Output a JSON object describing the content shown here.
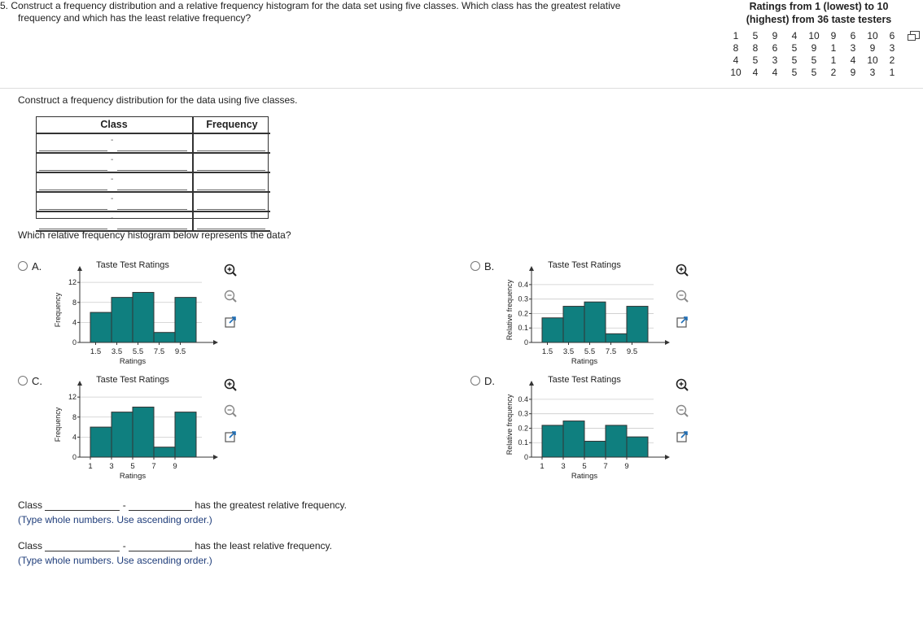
{
  "question": {
    "number": "5.",
    "line1": "Construct a frequency distribution and a relative frequency histogram for the data set using five classes. Which class has the greatest relative",
    "line2": "frequency and which has the least relative frequency?"
  },
  "dataset": {
    "title_line1": "Ratings from 1 (lowest) to 10",
    "title_line2": "(highest) from 36 taste testers",
    "rows": [
      [
        "1",
        "5",
        "9",
        "4",
        "10",
        "9",
        "6",
        "10",
        "6"
      ],
      [
        "8",
        "8",
        "6",
        "5",
        "9",
        "1",
        "3",
        "9",
        "3"
      ],
      [
        "4",
        "5",
        "3",
        "5",
        "5",
        "1",
        "4",
        "10",
        "2"
      ],
      [
        "10",
        "4",
        "4",
        "5",
        "5",
        "2",
        "9",
        "3",
        "1"
      ]
    ]
  },
  "step": {
    "instruction": "Construct a frequency distribution for the data using five classes.",
    "table": {
      "col_class": "Class",
      "col_frequency": "Frequency",
      "row_dash": "-"
    }
  },
  "histogram_question": "Which relative frequency histogram below represents the data?",
  "options": [
    {
      "label": "A.",
      "letter": "A"
    },
    {
      "label": "B.",
      "letter": "B"
    },
    {
      "label": "C.",
      "letter": "C"
    },
    {
      "label": "D.",
      "letter": "D"
    }
  ],
  "answers": {
    "greatest": {
      "prefix": "Class",
      "dash": "-",
      "suffix": "has the greatest relative frequency.",
      "hint": "(Type whole numbers. Use ascending order.)"
    },
    "least": {
      "prefix": "Class",
      "dash": "-",
      "suffix": "has the least relative frequency.",
      "hint": "(Type whole numbers. Use ascending order.)"
    }
  },
  "icons": [
    "zoom-in-icon",
    "zoom-out-icon",
    "open-external-icon",
    "copy-data-icon",
    "radio-icon"
  ],
  "colors": {
    "bar_fill": "#0f7f7f",
    "bar_stroke": "#333333",
    "axis": "#333333",
    "grid": "#cccccc"
  },
  "chart_data": [
    {
      "id": "A",
      "type": "bar",
      "title": "Taste Test Ratings",
      "xlabel": "Ratings",
      "ylabel": "Frequency",
      "x_ticks": [
        "1.5",
        "3.5",
        "5.5",
        "7.5",
        "9.5"
      ],
      "y_ticks": [
        "0",
        "4",
        "8",
        "12"
      ],
      "ylim": [
        0,
        13
      ],
      "bins": [
        [
          1,
          3
        ],
        [
          3,
          5
        ],
        [
          5,
          7
        ],
        [
          7,
          9
        ],
        [
          9,
          11
        ]
      ],
      "values": [
        6,
        9,
        10,
        2,
        9
      ],
      "grid": true
    },
    {
      "id": "B",
      "type": "bar",
      "title": "Taste Test Ratings",
      "xlabel": "Ratings",
      "ylabel": "Relative frequency",
      "x_ticks": [
        "1.5",
        "3.5",
        "5.5",
        "7.5",
        "9.5"
      ],
      "y_ticks": [
        "0",
        "0.1",
        "0.2",
        "0.3",
        "0.4"
      ],
      "ylim": [
        0,
        0.45
      ],
      "bins": [
        [
          1,
          3
        ],
        [
          3,
          5
        ],
        [
          5,
          7
        ],
        [
          7,
          9
        ],
        [
          9,
          11
        ]
      ],
      "values": [
        0.17,
        0.25,
        0.28,
        0.06,
        0.25
      ],
      "grid": true
    },
    {
      "id": "C",
      "type": "bar",
      "title": "Taste Test Ratings",
      "xlabel": "Ratings",
      "ylabel": "Frequency",
      "x_ticks": [
        "1",
        "3",
        "5",
        "7",
        "9"
      ],
      "y_ticks": [
        "0",
        "4",
        "8",
        "12"
      ],
      "ylim": [
        0,
        13
      ],
      "bins": [
        [
          1,
          3
        ],
        [
          3,
          5
        ],
        [
          5,
          7
        ],
        [
          7,
          9
        ],
        [
          9,
          11
        ]
      ],
      "values": [
        6,
        9,
        10,
        2,
        9
      ],
      "grid": true
    },
    {
      "id": "D",
      "type": "bar",
      "title": "Taste Test Ratings",
      "xlabel": "Ratings",
      "ylabel": "Relative frequency",
      "x_ticks": [
        "1",
        "3",
        "5",
        "7",
        "9"
      ],
      "y_ticks": [
        "0",
        "0.1",
        "0.2",
        "0.3",
        "0.4"
      ],
      "ylim": [
        0,
        0.45
      ],
      "bins": [
        [
          1,
          3
        ],
        [
          3,
          5
        ],
        [
          5,
          7
        ],
        [
          7,
          9
        ],
        [
          9,
          11
        ]
      ],
      "values": [
        0.22,
        0.25,
        0.11,
        0.22,
        0.14
      ],
      "grid": true
    }
  ]
}
